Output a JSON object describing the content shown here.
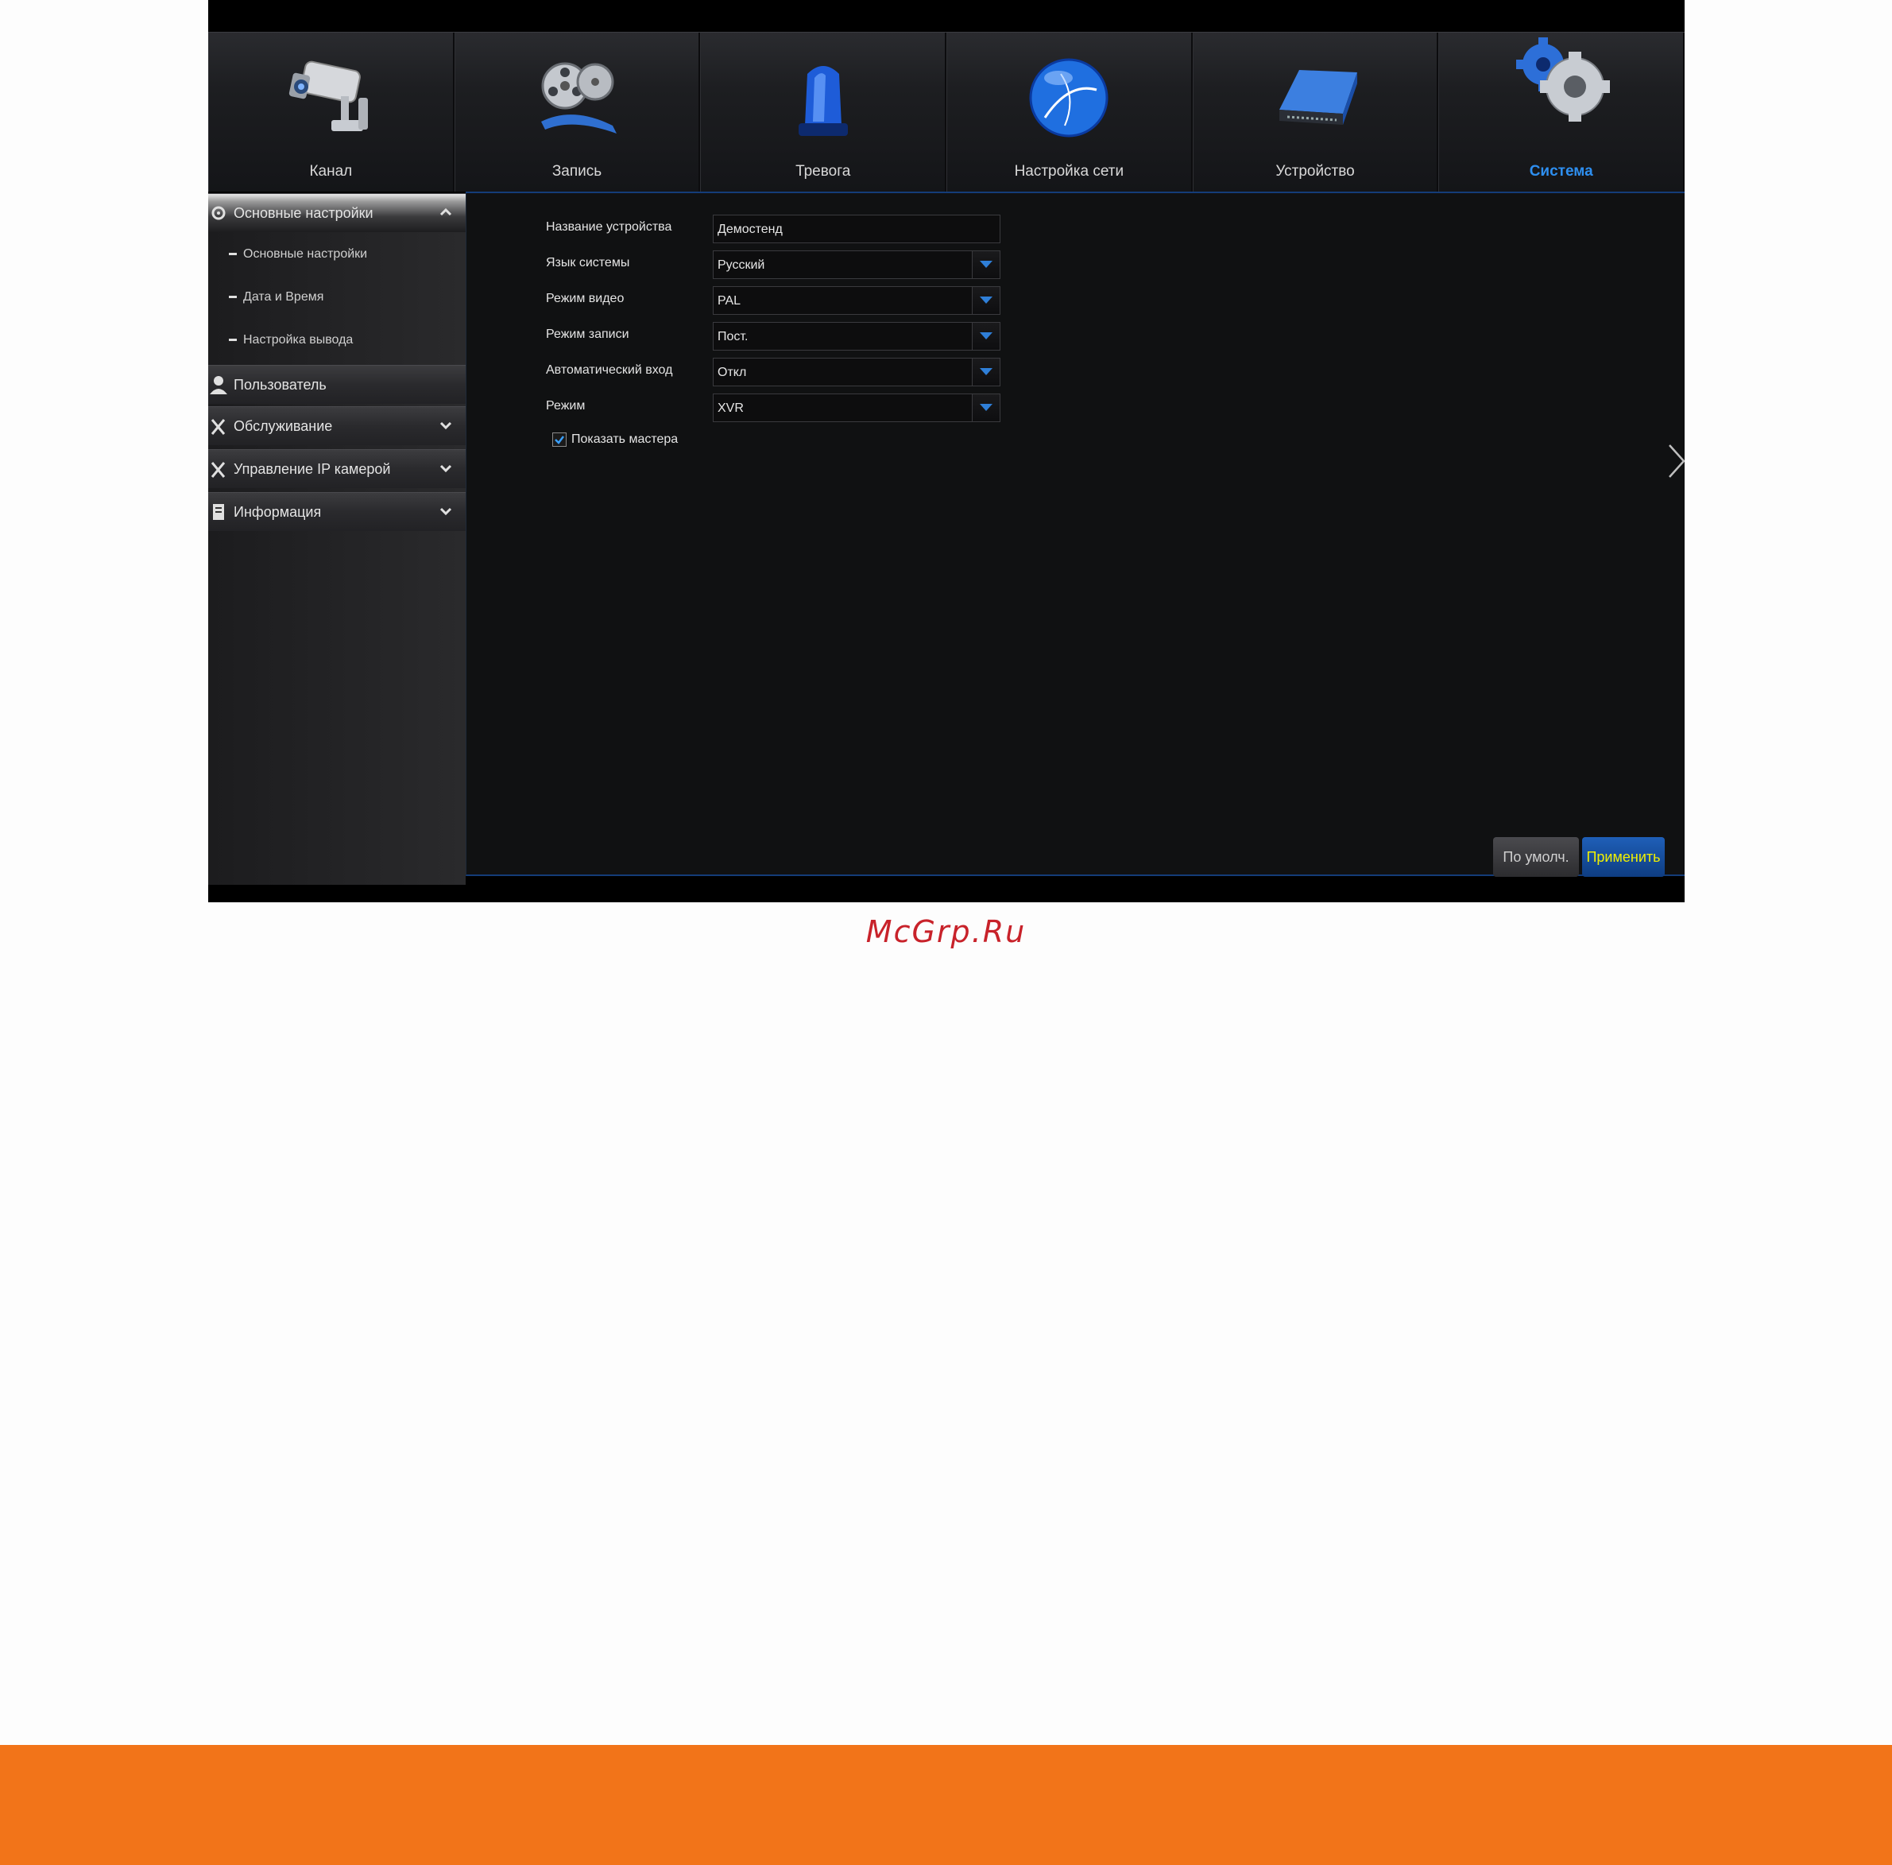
{
  "nav": [
    {
      "label": "Канал",
      "icon": "camera-icon"
    },
    {
      "label": "Запись",
      "icon": "film-reel-icon"
    },
    {
      "label": "Тревога",
      "icon": "alarm-light-icon"
    },
    {
      "label": "Настройка сети",
      "icon": "globe-icon"
    },
    {
      "label": "Устройство",
      "icon": "hard-drive-icon"
    },
    {
      "label": "Система",
      "icon": "gears-icon",
      "active": true
    }
  ],
  "sidebar": {
    "basic": {
      "label": "Основные настройки",
      "subitems": [
        "Основные настройки",
        "Дата и Время",
        "Настройка вывода"
      ]
    },
    "user": {
      "label": "Пользователь"
    },
    "maintenance": {
      "label": "Обслуживание"
    },
    "ipcam": {
      "label": "Управление IP камерой"
    },
    "info": {
      "label": "Информация"
    }
  },
  "form": {
    "device_name": {
      "label": "Название устройства",
      "value": "Демостенд"
    },
    "language": {
      "label": "Язык системы",
      "value": "Русский"
    },
    "video_mode": {
      "label": "Режим видео",
      "value": "PAL"
    },
    "record_mode": {
      "label": "Режим записи",
      "value": "Пост."
    },
    "auto_login": {
      "label": "Автоматический вход",
      "value": "Откл"
    },
    "mode": {
      "label": "Режим",
      "value": "XVR"
    },
    "show_wizard": {
      "label": "Показать мастера",
      "checked": true
    }
  },
  "buttons": {
    "default": "По умолч.",
    "apply": "Применить"
  },
  "watermark": "McGrp.Ru",
  "colors": {
    "accent": "#2e8ff0",
    "apply_text": "#f0f000",
    "watermark": "#c8222a",
    "footer": "#f27419"
  }
}
